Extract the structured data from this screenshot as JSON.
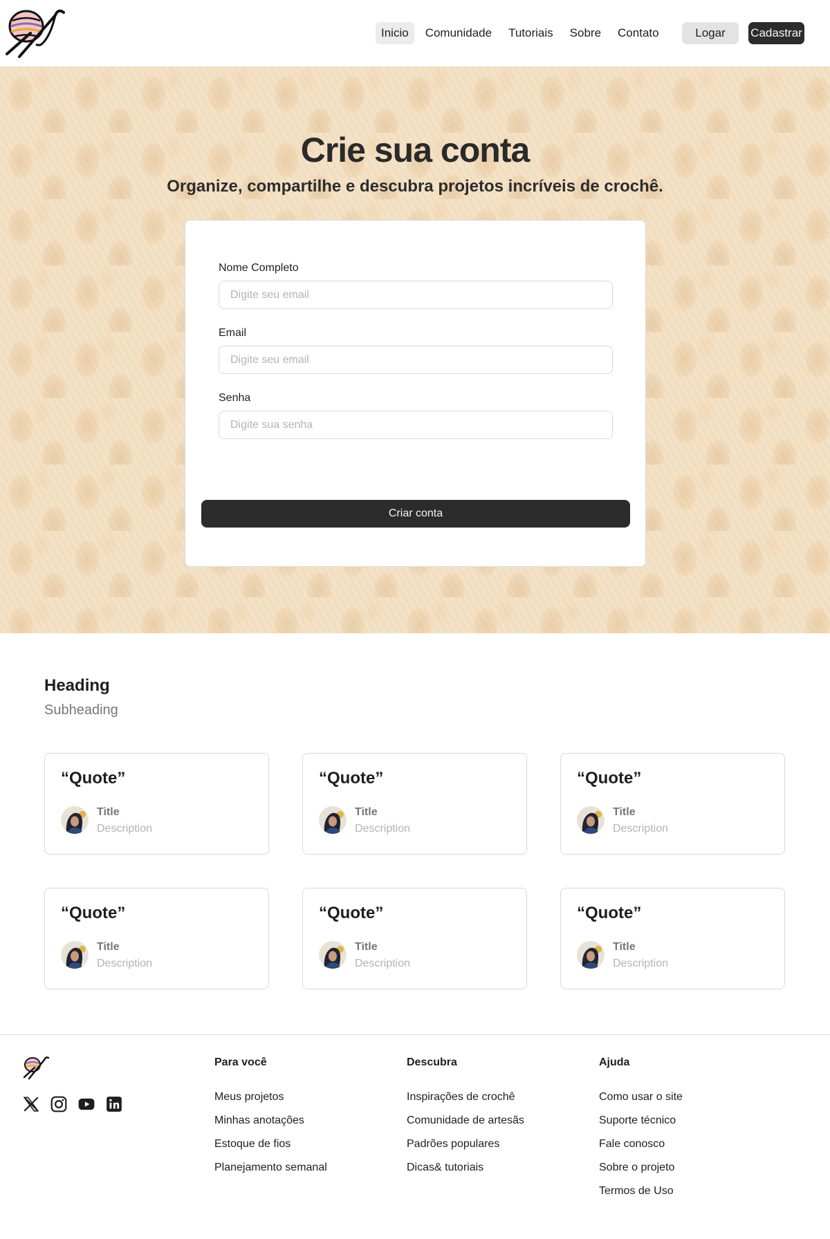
{
  "header": {
    "nav": [
      "Inicio",
      "Comunidade",
      "Tutoriais",
      "Sobre",
      "Contato"
    ],
    "login_label": "Logar",
    "signup_label": "Cadastrar"
  },
  "hero": {
    "title": "Crie sua conta",
    "subtitle": "Organize, compartilhe e descubra projetos incríveis de crochê."
  },
  "form": {
    "name_label": "Nome Completo",
    "name_placeholder": "Digite seu email",
    "email_label": "Email",
    "email_placeholder": "Digite seu email",
    "password_label": "Senha",
    "password_placeholder": "Digite sua senha",
    "submit_label": "Criar conta"
  },
  "testimonials": {
    "heading": "Heading",
    "subheading": "Subheading",
    "cards": [
      {
        "quote": "“Quote”",
        "title": "Title",
        "description": "Description"
      },
      {
        "quote": "“Quote”",
        "title": "Title",
        "description": "Description"
      },
      {
        "quote": "“Quote”",
        "title": "Title",
        "description": "Description"
      },
      {
        "quote": "“Quote”",
        "title": "Title",
        "description": "Description"
      },
      {
        "quote": "“Quote”",
        "title": "Title",
        "description": "Description"
      },
      {
        "quote": "“Quote”",
        "title": "Title",
        "description": "Description"
      }
    ]
  },
  "footer": {
    "social_icons": [
      "x-icon",
      "instagram-icon",
      "youtube-icon",
      "linkedin-icon"
    ],
    "columns": [
      {
        "title": "Para você",
        "links": [
          "Meus projetos",
          "Minhas anotações",
          "Estoque de fios",
          "Planejamento semanal"
        ]
      },
      {
        "title": "Descubra",
        "links": [
          "Inspirações de crochê",
          "Comunidade de artesãs",
          "Padrões populares",
          "Dicas& tutoriais"
        ]
      },
      {
        "title": "Ajuda",
        "links": [
          "Como usar o site",
          "Suporte técnico",
          "Fale conosco",
          "Sobre o projeto",
          "Termos de Uso"
        ]
      }
    ]
  },
  "colors": {
    "primary_button": "#2c2c2c",
    "secondary_button": "#e3e3e3",
    "hero_background": "#f2ddbf",
    "muted_text": "#757575"
  }
}
